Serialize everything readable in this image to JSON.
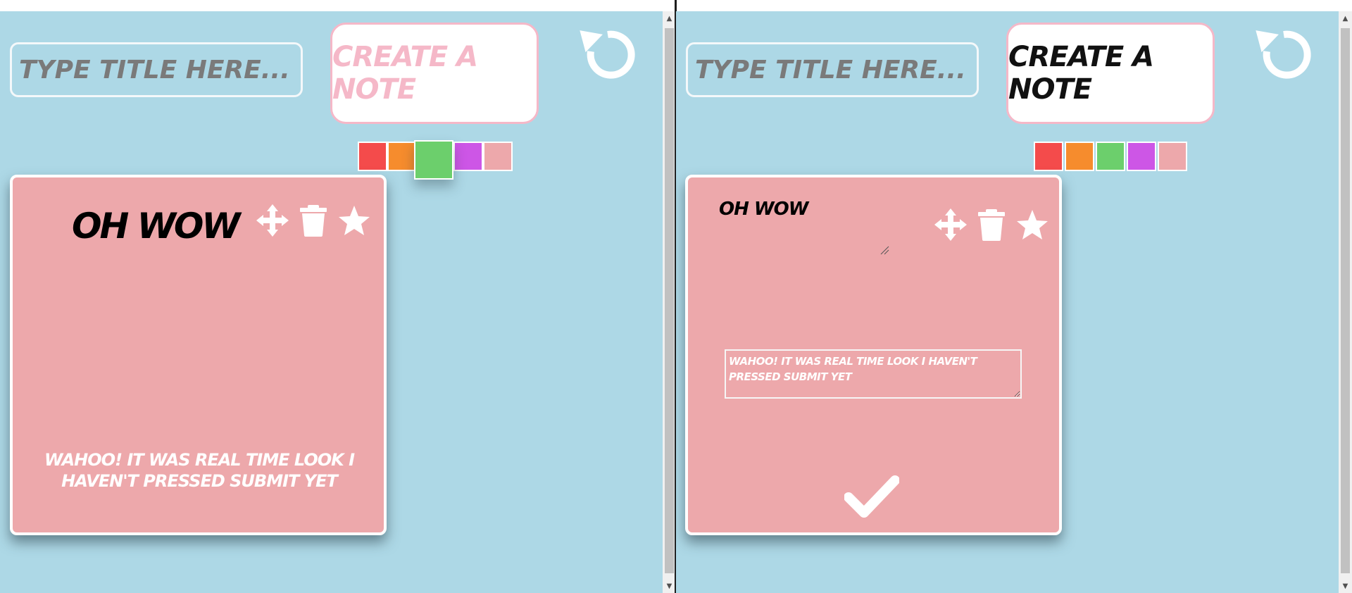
{
  "colors": {
    "background": "#add8e6",
    "note": "#eda8ab",
    "create_border": "#f5b8c8"
  },
  "left_pane": {
    "title_input": {
      "placeholder": "TYPE TITLE HERE...",
      "value": ""
    },
    "create_button": {
      "label": "CREATE A NOTE"
    },
    "reset_icon": "undo-icon",
    "swatches": [
      {
        "name": "red",
        "color": "#f44b4b"
      },
      {
        "name": "orange",
        "color": "#f68c2d"
      },
      {
        "name": "green",
        "color": "#6ccf6c",
        "selected": true
      },
      {
        "name": "purple",
        "color": "#cd56e6"
      },
      {
        "name": "pink",
        "color": "#eda8ab"
      }
    ],
    "note": {
      "title": "OH WOW",
      "body": "WAHOO! IT WAS REAL TIME LOOK I HAVEN'T PRESSED SUBMIT YET",
      "icons": [
        "move-icon",
        "trash-icon",
        "star-icon"
      ]
    }
  },
  "right_pane": {
    "title_input": {
      "placeholder": "TYPE TITLE HERE...",
      "value": ""
    },
    "create_button": {
      "label": "CREATE A NOTE"
    },
    "reset_icon": "undo-icon",
    "swatches": [
      {
        "name": "red",
        "color": "#f44b4b"
      },
      {
        "name": "orange",
        "color": "#f68c2d"
      },
      {
        "name": "green",
        "color": "#6ccf6c"
      },
      {
        "name": "purple",
        "color": "#cd56e6"
      },
      {
        "name": "pink",
        "color": "#eda8ab"
      }
    ],
    "note": {
      "title": "OH WOW",
      "textarea_value": "WAHOO! IT WAS REAL TIME LOOK I HAVEN'T PRESSED SUBMIT YET",
      "icons": [
        "move-icon",
        "trash-icon",
        "star-icon",
        "check-icon"
      ]
    }
  }
}
